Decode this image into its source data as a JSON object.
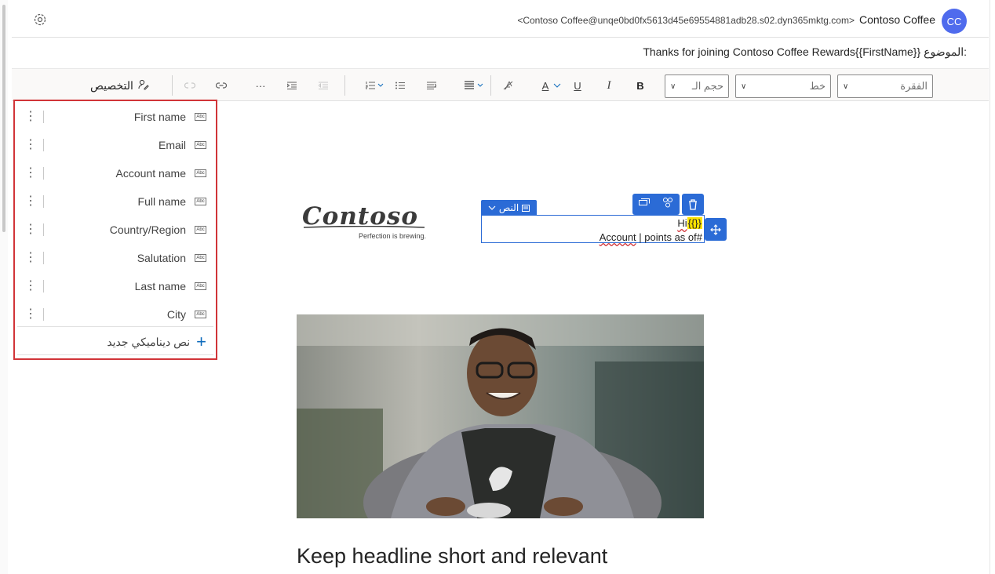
{
  "header": {
    "sender_address": "<Contoso Coffee@unqe0bd0fx5613d45e69554881adb28.s02.dyn365mktg.com>",
    "sender_name": "Contoso Coffee",
    "avatar_initials": "CC",
    "subject_label": "الموضوع:",
    "subject_value": "Thanks for joining Contoso Coffee Rewards{{FirstName}}"
  },
  "toolbar": {
    "customize_label": "التخصيص",
    "more_label": "···",
    "paragraph_select": "الفقرة",
    "font_select": "خط",
    "size_select": "حجم الـ",
    "bold": "B",
    "italic": "I",
    "underline": "U",
    "font_color": "A"
  },
  "dynamic_panel": {
    "items": [
      {
        "label": "First name",
        "type_icon": "Abc"
      },
      {
        "label": "Email",
        "type_icon": "Abc"
      },
      {
        "label": "Account name",
        "type_icon": "Abc"
      },
      {
        "label": "Full name",
        "type_icon": "Abc"
      },
      {
        "label": "Country/Region",
        "type_icon": "Abc"
      },
      {
        "label": "Salutation",
        "type_icon": "Abc"
      },
      {
        "label": "Last name",
        "type_icon": "Abc"
      },
      {
        "label": "City",
        "type_icon": "Abc"
      }
    ],
    "new_label": "نص ديناميكي جديد"
  },
  "canvas": {
    "logo_text": "Contoso",
    "logo_tagline": "Perfection is brewing.",
    "text_block_label": "النص",
    "text_line1_word": "Hi",
    "text_line1_placeholder": "{{}}",
    "text_line2_account": "Account",
    "text_line2_rest": " | points as of",
    "text_line2_end": "#",
    "headline": "Keep headline short and relevant"
  },
  "colors": {
    "accent": "#2b6bd6",
    "avatar": "#4f6bed",
    "panel_border": "#d13438",
    "placeholder_highlight": "#fde300"
  }
}
